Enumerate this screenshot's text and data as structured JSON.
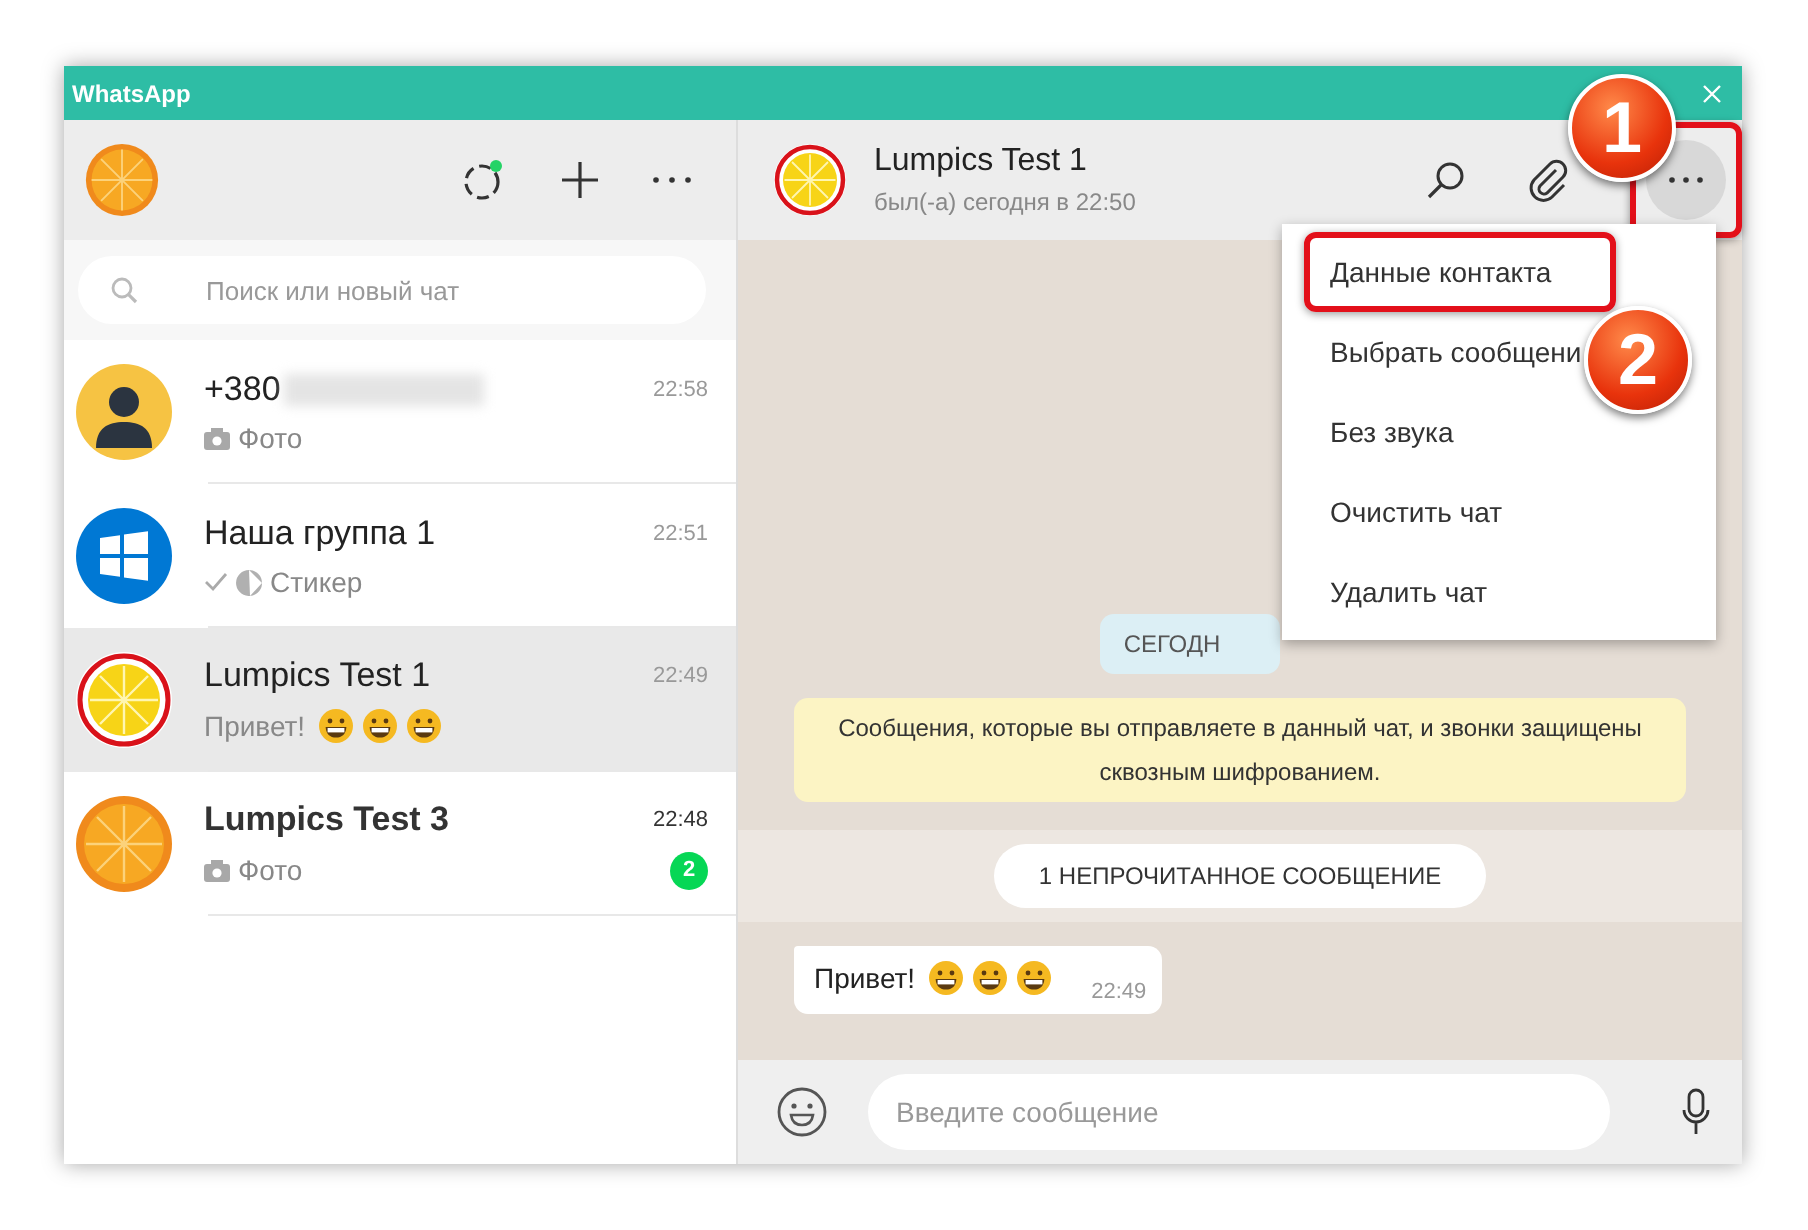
{
  "window": {
    "title": "WhatsApp"
  },
  "sidebar": {
    "search": {
      "placeholder": "Поиск или новый чат"
    }
  },
  "chats": [
    {
      "avatar": {
        "kind": "person"
      },
      "name": "+380",
      "redacted": true,
      "preview": [
        {
          "kind": "camera"
        },
        {
          "kind": "text",
          "text": "Фото"
        }
      ],
      "time": "22:58",
      "selected": false
    },
    {
      "avatar": {
        "kind": "windows"
      },
      "name": "Наша группа 1",
      "redacted": false,
      "preview": [
        {
          "kind": "tick"
        },
        {
          "kind": "sticker"
        },
        {
          "kind": "text",
          "text": "Стикер"
        }
      ],
      "time": "22:51",
      "selected": false
    },
    {
      "avatar": {
        "kind": "lemon"
      },
      "name": "Lumpics Test 1",
      "redacted": false,
      "preview": [
        {
          "kind": "text",
          "text": "Привет!"
        },
        {
          "kind": "emoji"
        },
        {
          "kind": "emoji"
        },
        {
          "kind": "emoji"
        }
      ],
      "time": "22:49",
      "selected": true
    },
    {
      "avatar": {
        "kind": "orange"
      },
      "name": "Lumpics Test 3",
      "redacted": false,
      "preview": [
        {
          "kind": "camera"
        },
        {
          "kind": "text",
          "text": "Фото"
        }
      ],
      "time": "22:48",
      "unread": "2",
      "selected": false
    }
  ],
  "conversation": {
    "avatar": {
      "kind": "lemon"
    },
    "name": "Lumpics Test 1",
    "status": "был(-а) сегодня в 22:50",
    "more_button": {
      "highlighted": true,
      "callout": "1"
    }
  },
  "menu": [
    {
      "label": "Данные контакта",
      "highlighted": true,
      "callout": "2"
    },
    {
      "label": "Выбрать сообщени",
      "highlighted": false
    },
    {
      "label": "Без звука",
      "highlighted": false
    },
    {
      "label": "Очистить чат",
      "highlighted": false
    },
    {
      "label": "Удалить чат",
      "highlighted": false
    }
  ],
  "messages": {
    "date_chip": "СЕГОДН",
    "notice": "Сообщения, которые вы отправляете в данный чат, и звонки защищены сквозным шифрованием.",
    "unread_divider": "1 НЕПРОЧИТАННОЕ СООБЩЕНИЕ",
    "incoming": {
      "parts": [
        {
          "kind": "text",
          "text": "Привет!"
        },
        {
          "kind": "emoji"
        },
        {
          "kind": "emoji"
        },
        {
          "kind": "emoji"
        }
      ],
      "time": "22:49"
    }
  },
  "composer": {
    "placeholder": "Введите сообщение"
  }
}
